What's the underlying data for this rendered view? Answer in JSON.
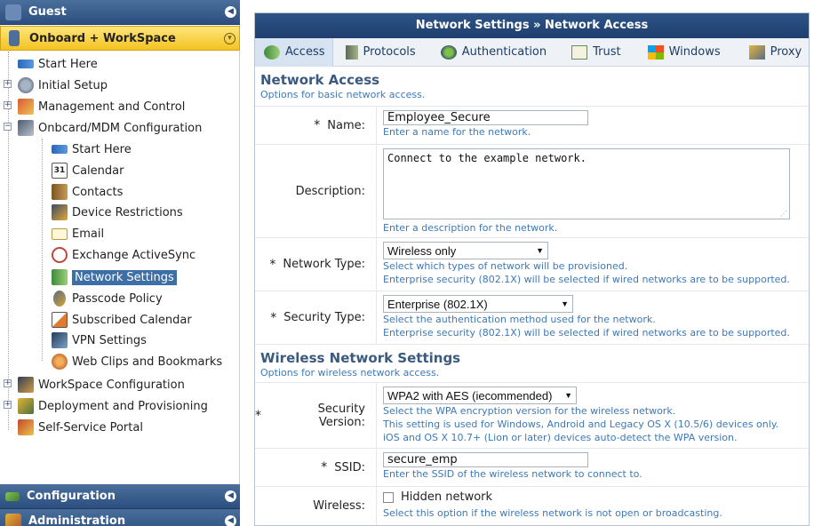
{
  "sidebar": {
    "guest": "Guest",
    "onboard": "Onboard + WorkSpace",
    "configuration": "Configuration",
    "administration": "Administration",
    "tree": [
      {
        "label": "Start Here"
      },
      {
        "label": "Initial Setup"
      },
      {
        "label": "Management and Control"
      },
      {
        "label": "Onbcard/MDM Configuration"
      },
      {
        "label": "Start Here"
      },
      {
        "label": "Calendar"
      },
      {
        "label": "Contacts"
      },
      {
        "label": "Device Restrictions"
      },
      {
        "label": "Email"
      },
      {
        "label": "Exchange ActiveSync"
      },
      {
        "label": "Network Settings"
      },
      {
        "label": "Passcode Policy"
      },
      {
        "label": "Subscribed Calendar"
      },
      {
        "label": "VPN Settings"
      },
      {
        "label": "Web Clips and Bookmarks"
      },
      {
        "label": "WorkSpace Configuration"
      },
      {
        "label": "Deployment and Provisioning"
      },
      {
        "label": "Self-Service Portal"
      }
    ],
    "calendar_day": "31"
  },
  "main": {
    "title": "Network Settings » Network Access",
    "tabs": [
      {
        "label": "Access"
      },
      {
        "label": "Protocols"
      },
      {
        "label": "Authentication"
      },
      {
        "label": "Trust"
      },
      {
        "label": "Windows"
      },
      {
        "label": "Proxy"
      }
    ],
    "network_access": {
      "title": "Network Access",
      "subtitle": "Options for basic network access.",
      "name_label": "Name:",
      "name_value": "Employee_Secure",
      "name_hint": "Enter a name for the network.",
      "desc_label": "Description:",
      "desc_value": "Connect to the example network.",
      "desc_hint": "Enter a description for the network.",
      "type_label": "Network Type:",
      "type_value": "Wireless only",
      "type_hint1": "Select which types of network will be provisioned.",
      "type_hint2": "Enterprise security (802.1X) will be selected if wired networks are to be supported.",
      "sec_label": "Security Type:",
      "sec_value": "Enterprise (802.1X)",
      "sec_hint1": "Select the authentication method used for the network.",
      "sec_hint2": "Enterprise security (802.1X) will be selected if wired networks are to be supported."
    },
    "wireless": {
      "title": "Wireless Network Settings",
      "subtitle": "Options for wireless network access.",
      "ver_label": "Security Version:",
      "ver_value": "WPA2 with AES (iecommended)",
      "ver_hint1": "Select the WPA encryption version for the wireless network.",
      "ver_hint2": "This setting is used for Windows, Android and Legacy OS X (10.5/6) devices only.",
      "ver_hint3": "iOS and OS X 10.7+ (Lion or later) devices auto-detect the WPA version.",
      "ssid_label": "SSID:",
      "ssid_value": "secure_emp",
      "ssid_hint": "Enter the SSID of the wireless network to connect to.",
      "wireless_label": "Wireless:",
      "hidden_label": "Hidden network",
      "hidden_hint": "Select this option if the wireless network is not open or broadcasting."
    },
    "required_mark": "*"
  }
}
